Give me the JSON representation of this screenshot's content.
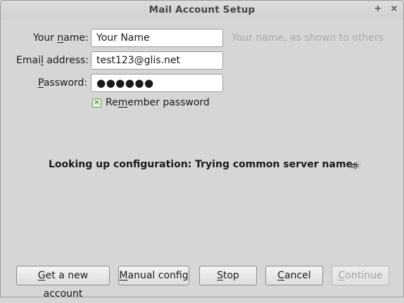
{
  "window": {
    "title": "Mail Account Setup",
    "maximize_glyph": "+",
    "close_glyph": "×"
  },
  "form": {
    "name": {
      "label_pre": "Your ",
      "label_key": "n",
      "label_post": "ame:",
      "value": "Your Name",
      "hint": "Your name, as shown to others"
    },
    "email": {
      "label_pre": "Emai",
      "label_key": "l",
      "label_post": " address:",
      "value": "test123@glis.net"
    },
    "password": {
      "label_pre": "",
      "label_key": "P",
      "label_post": "assword:",
      "value_masked": "●●●●●●"
    },
    "remember": {
      "checked": true,
      "check_glyph": "✕",
      "label_pre": "Re",
      "label_key": "m",
      "label_post": "ember password"
    }
  },
  "status": {
    "text": "Looking up configuration: Trying common server names",
    "icon": "spinner-icon"
  },
  "buttons": {
    "get_account": {
      "pre": "",
      "key": "G",
      "post": "et a new account"
    },
    "manual_config": {
      "pre": "",
      "key": "M",
      "post": "anual config"
    },
    "stop": {
      "pre": "",
      "key": "S",
      "post": "top"
    },
    "cancel": {
      "pre": "",
      "key": "C",
      "post": "ancel"
    },
    "continue": {
      "pre": "",
      "key": "C",
      "post": "ontinue",
      "disabled": true
    }
  },
  "colors": {
    "background": "#d6d6d6",
    "hint_text": "#a9a9a9",
    "checkbox_accent": "#6f9b59"
  }
}
